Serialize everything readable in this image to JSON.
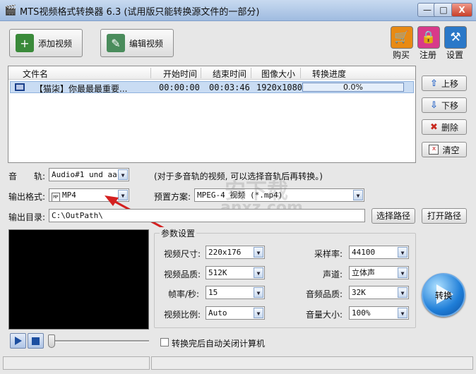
{
  "window": {
    "title": "MTS视频格式转换器 6.3 (试用版只能转换源文件的一部分)",
    "minimize": "—",
    "maximize": "□",
    "close": "X"
  },
  "toolbar": {
    "add_video": "添加视频",
    "edit_video": "编辑视频",
    "buy": "购买",
    "register": "注册",
    "settings": "设置"
  },
  "file_list": {
    "columns": [
      "文件名",
      "开始时间",
      "结束时间",
      "图像大小",
      "转换进度"
    ],
    "rows": [
      {
        "name": "【猫柒】你最最最重要...",
        "start": "00:00:00",
        "end": "00:03:46",
        "size": "1920x1080",
        "progress": "0.0%",
        "progress_value": 0.0
      }
    ]
  },
  "side_buttons": {
    "move_up": "上移",
    "move_down": "下移",
    "delete": "删除",
    "clear": "清空"
  },
  "audio_track": {
    "label": "音　　轨:",
    "value": "Audio#1 und aac",
    "hint": "(对于多音轨的视频, 可以选择音轨后再转换。)"
  },
  "output_format": {
    "label": "输出格式:",
    "value": "MP4"
  },
  "preset": {
    "label": "预置方案:",
    "value": "MPEG-4 视频 (*.mp4)"
  },
  "output_dir": {
    "label": "输出目录:",
    "value": "C:\\OutPath\\",
    "choose_button": "选择路径",
    "open_button": "打开路径"
  },
  "params": {
    "title": "参数设置",
    "video_size": {
      "label": "视频尺寸:",
      "value": "220x176"
    },
    "video_quality": {
      "label": "视频品质:",
      "value": "512K"
    },
    "frame_rate": {
      "label": "帧率/秒:",
      "value": "15"
    },
    "aspect_ratio": {
      "label": "视频比例:",
      "value": "Auto"
    },
    "sample_rate": {
      "label": "采样率:",
      "value": "44100"
    },
    "channels": {
      "label": "声道:",
      "value": "立体声"
    },
    "audio_quality": {
      "label": "音频品质:",
      "value": "32K"
    },
    "volume": {
      "label": "音量大小:",
      "value": "100%"
    }
  },
  "player": {
    "slider_value": 0
  },
  "shutdown_checkbox": {
    "label": "转换完后自动关闭计算机",
    "checked": false
  },
  "convert_button": "转换",
  "watermark": {
    "cn": "安下载",
    "en": "anxz.com"
  },
  "colors": {
    "title_bar": "#9fbbe0",
    "selected_row": "#c9dcf3",
    "annotation_arrow": "#d42020",
    "convert_button": "#1f7ed8"
  }
}
